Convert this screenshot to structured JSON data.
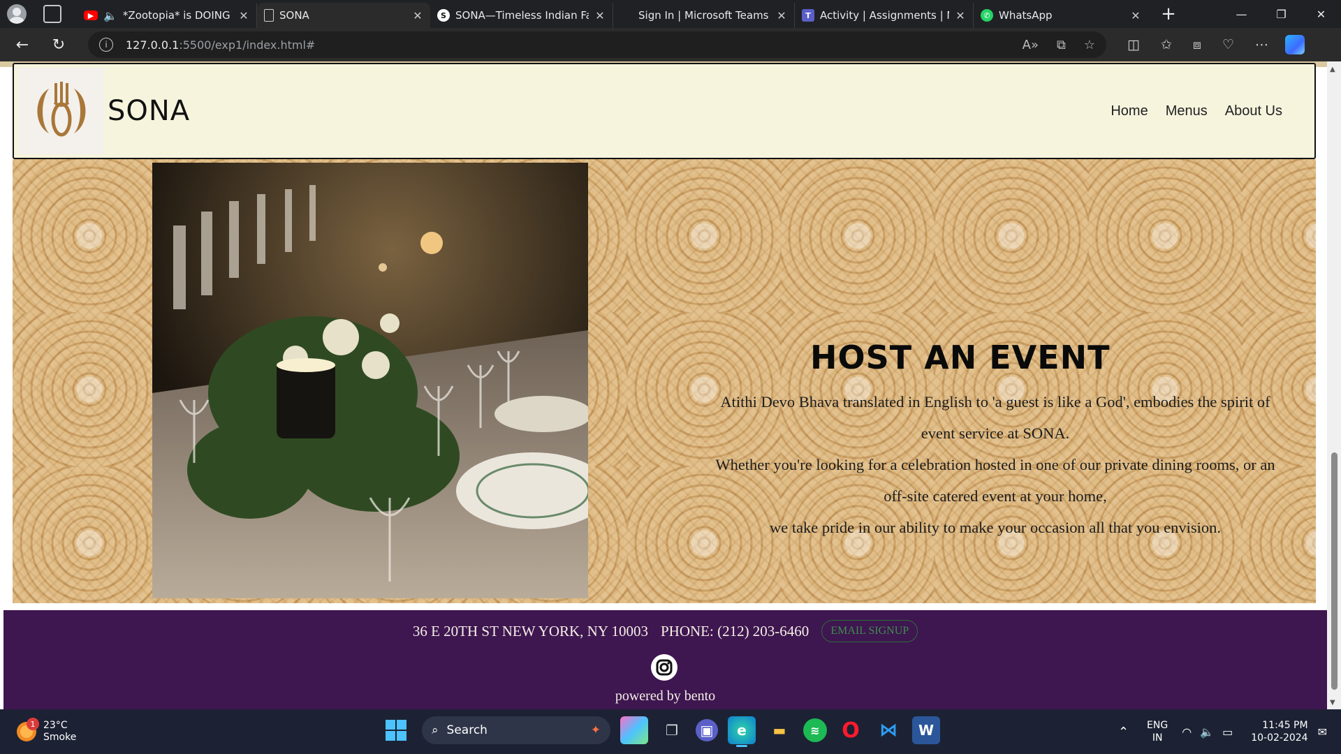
{
  "browser": {
    "tabs": [
      {
        "title": "*Zootopia* is DOING",
        "icon": "youtube-icon",
        "color": "#ff0000",
        "active": false
      },
      {
        "title": "SONA",
        "icon": "page-icon",
        "color": "#cfcfcf",
        "active": true
      },
      {
        "title": "SONA—Timeless Indian Fa",
        "icon": "sona-icon",
        "color": "#ffffff",
        "active": false
      },
      {
        "title": "Sign In | Microsoft Teams",
        "icon": "microsoft-icon",
        "color": "#f25022",
        "active": false
      },
      {
        "title": "Activity | Assignments | Mi",
        "icon": "teams-icon",
        "color": "#5b5fc7",
        "active": false
      },
      {
        "title": "WhatsApp",
        "icon": "whatsapp-icon",
        "color": "#25d366",
        "active": false
      }
    ],
    "url_host": "127.0.0.1",
    "url_path": ":5500/exp1/index.html#"
  },
  "site": {
    "brand": "SONA",
    "nav": [
      "Home",
      "Menus",
      "About Us"
    ],
    "hero": {
      "title": "HOST AN EVENT",
      "paragraphs": [
        "Atithi Devo Bhava translated in English to 'a guest is like a God', embodies the spirit of event service at SONA.",
        "Whether you're looking for a celebration hosted in one of our private dining rooms, or an off-site catered event at your home,",
        "we take pride in our ability to make your occasion all that you envision."
      ]
    },
    "footer": {
      "address": "36 E 20TH ST NEW YORK, NY 10003",
      "phone": "PHONE: (212) 203-6460",
      "email_button": "EMAIL SIGNUP",
      "powered": "powered by bento"
    },
    "colors": {
      "header_bg": "#f7f4de",
      "footer_bg": "#3e1650",
      "accent_gold": "#a9773a"
    }
  },
  "taskbar": {
    "weather_temp": "23°C",
    "weather_desc": "Smoke",
    "weather_badge": "1",
    "search_label": "Search",
    "lang_top": "ENG",
    "lang_bottom": "IN",
    "time": "11:45 PM",
    "date": "10-02-2024"
  }
}
